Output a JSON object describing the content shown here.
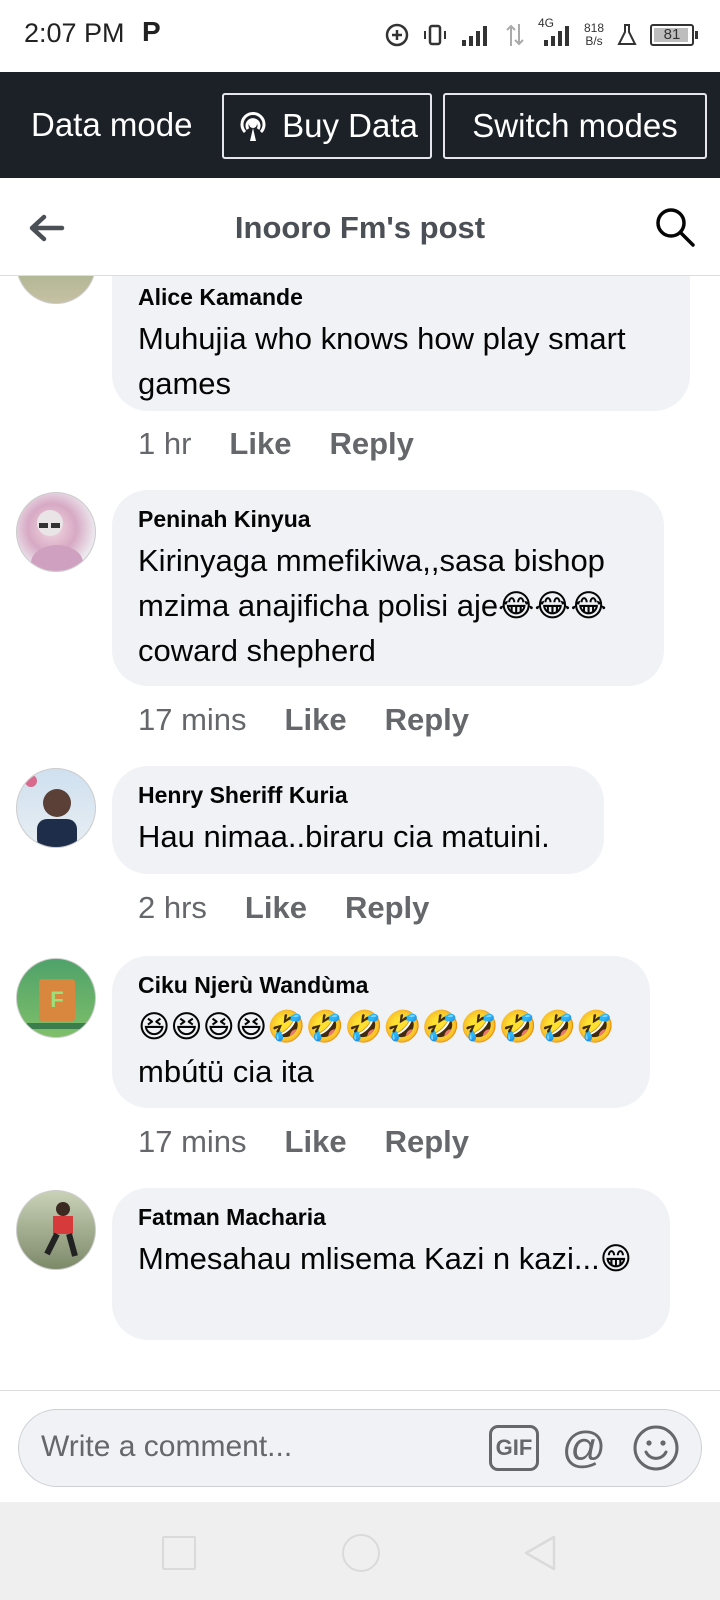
{
  "status_bar": {
    "time": "2:07 PM",
    "carrier_icon": "P",
    "net_speed_value": "818",
    "net_speed_unit": "B/s",
    "network": "4G",
    "battery": "81"
  },
  "data_banner": {
    "label": "Data mode",
    "buy_data": "Buy Data",
    "switch_modes": "Switch modes"
  },
  "header": {
    "title": "Inooro Fm's post",
    "back_icon": "arrow-left-icon",
    "search_icon": "search-icon"
  },
  "comments": [
    {
      "author": "Alice Kamande",
      "text": "Muhujia who knows how play smart games",
      "time": "1 hr",
      "like": "Like",
      "reply": "Reply"
    },
    {
      "author": "Peninah Kinyua",
      "text": "Kirinyaga mmefikiwa,,sasa bishop mzima anajificha polisi aje😂😂😂coward shepherd",
      "time": "17 mins",
      "like": "Like",
      "reply": "Reply"
    },
    {
      "author": "Henry Sheriff Kuria",
      "text": "Hau nimaa..biraru cia matuini.",
      "time": "2 hrs",
      "like": "Like",
      "reply": "Reply"
    },
    {
      "author": "Ciku Njerù Wandùma",
      "text": "😆😆😆😆🤣🤣🤣🤣🤣🤣🤣🤣🤣mbútü cia ita",
      "time": "17 mins",
      "like": "Like",
      "reply": "Reply"
    },
    {
      "author": "Fatman Macharia",
      "text": "Mmesahau  mlisema Kazi  n kazi...😁",
      "time": "",
      "like": "",
      "reply": ""
    }
  ],
  "comment_bar": {
    "placeholder": "Write a comment...",
    "gif_label": "GIF",
    "at_label": "@",
    "emoji_icon": "smiley-icon"
  },
  "colors": {
    "banner_bg": "#1c2128",
    "bubble_bg": "#f0f2f5",
    "meta_text": "#65676b"
  }
}
